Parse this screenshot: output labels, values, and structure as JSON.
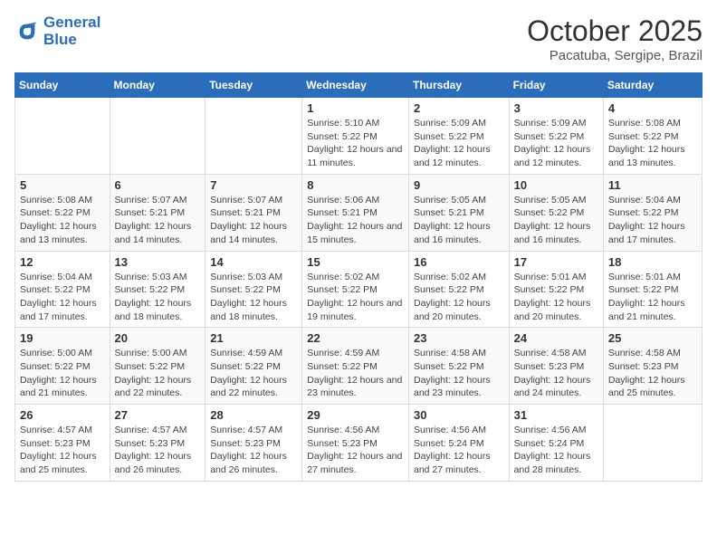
{
  "logo": {
    "line1": "General",
    "line2": "Blue"
  },
  "title": "October 2025",
  "subtitle": "Pacatuba, Sergipe, Brazil",
  "weekdays": [
    "Sunday",
    "Monday",
    "Tuesday",
    "Wednesday",
    "Thursday",
    "Friday",
    "Saturday"
  ],
  "weeks": [
    [
      {
        "day": "",
        "info": ""
      },
      {
        "day": "",
        "info": ""
      },
      {
        "day": "",
        "info": ""
      },
      {
        "day": "1",
        "sunrise": "5:10 AM",
        "sunset": "5:22 PM",
        "daylight": "12 hours and 11 minutes."
      },
      {
        "day": "2",
        "sunrise": "5:09 AM",
        "sunset": "5:22 PM",
        "daylight": "12 hours and 12 minutes."
      },
      {
        "day": "3",
        "sunrise": "5:09 AM",
        "sunset": "5:22 PM",
        "daylight": "12 hours and 12 minutes."
      },
      {
        "day": "4",
        "sunrise": "5:08 AM",
        "sunset": "5:22 PM",
        "daylight": "12 hours and 13 minutes."
      }
    ],
    [
      {
        "day": "5",
        "sunrise": "5:08 AM",
        "sunset": "5:22 PM",
        "daylight": "12 hours and 13 minutes."
      },
      {
        "day": "6",
        "sunrise": "5:07 AM",
        "sunset": "5:21 PM",
        "daylight": "12 hours and 14 minutes."
      },
      {
        "day": "7",
        "sunrise": "5:07 AM",
        "sunset": "5:21 PM",
        "daylight": "12 hours and 14 minutes."
      },
      {
        "day": "8",
        "sunrise": "5:06 AM",
        "sunset": "5:21 PM",
        "daylight": "12 hours and 15 minutes."
      },
      {
        "day": "9",
        "sunrise": "5:05 AM",
        "sunset": "5:21 PM",
        "daylight": "12 hours and 16 minutes."
      },
      {
        "day": "10",
        "sunrise": "5:05 AM",
        "sunset": "5:22 PM",
        "daylight": "12 hours and 16 minutes."
      },
      {
        "day": "11",
        "sunrise": "5:04 AM",
        "sunset": "5:22 PM",
        "daylight": "12 hours and 17 minutes."
      }
    ],
    [
      {
        "day": "12",
        "sunrise": "5:04 AM",
        "sunset": "5:22 PM",
        "daylight": "12 hours and 17 minutes."
      },
      {
        "day": "13",
        "sunrise": "5:03 AM",
        "sunset": "5:22 PM",
        "daylight": "12 hours and 18 minutes."
      },
      {
        "day": "14",
        "sunrise": "5:03 AM",
        "sunset": "5:22 PM",
        "daylight": "12 hours and 18 minutes."
      },
      {
        "day": "15",
        "sunrise": "5:02 AM",
        "sunset": "5:22 PM",
        "daylight": "12 hours and 19 minutes."
      },
      {
        "day": "16",
        "sunrise": "5:02 AM",
        "sunset": "5:22 PM",
        "daylight": "12 hours and 20 minutes."
      },
      {
        "day": "17",
        "sunrise": "5:01 AM",
        "sunset": "5:22 PM",
        "daylight": "12 hours and 20 minutes."
      },
      {
        "day": "18",
        "sunrise": "5:01 AM",
        "sunset": "5:22 PM",
        "daylight": "12 hours and 21 minutes."
      }
    ],
    [
      {
        "day": "19",
        "sunrise": "5:00 AM",
        "sunset": "5:22 PM",
        "daylight": "12 hours and 21 minutes."
      },
      {
        "day": "20",
        "sunrise": "5:00 AM",
        "sunset": "5:22 PM",
        "daylight": "12 hours and 22 minutes."
      },
      {
        "day": "21",
        "sunrise": "4:59 AM",
        "sunset": "5:22 PM",
        "daylight": "12 hours and 22 minutes."
      },
      {
        "day": "22",
        "sunrise": "4:59 AM",
        "sunset": "5:22 PM",
        "daylight": "12 hours and 23 minutes."
      },
      {
        "day": "23",
        "sunrise": "4:58 AM",
        "sunset": "5:22 PM",
        "daylight": "12 hours and 23 minutes."
      },
      {
        "day": "24",
        "sunrise": "4:58 AM",
        "sunset": "5:23 PM",
        "daylight": "12 hours and 24 minutes."
      },
      {
        "day": "25",
        "sunrise": "4:58 AM",
        "sunset": "5:23 PM",
        "daylight": "12 hours and 25 minutes."
      }
    ],
    [
      {
        "day": "26",
        "sunrise": "4:57 AM",
        "sunset": "5:23 PM",
        "daylight": "12 hours and 25 minutes."
      },
      {
        "day": "27",
        "sunrise": "4:57 AM",
        "sunset": "5:23 PM",
        "daylight": "12 hours and 26 minutes."
      },
      {
        "day": "28",
        "sunrise": "4:57 AM",
        "sunset": "5:23 PM",
        "daylight": "12 hours and 26 minutes."
      },
      {
        "day": "29",
        "sunrise": "4:56 AM",
        "sunset": "5:23 PM",
        "daylight": "12 hours and 27 minutes."
      },
      {
        "day": "30",
        "sunrise": "4:56 AM",
        "sunset": "5:24 PM",
        "daylight": "12 hours and 27 minutes."
      },
      {
        "day": "31",
        "sunrise": "4:56 AM",
        "sunset": "5:24 PM",
        "daylight": "12 hours and 28 minutes."
      },
      {
        "day": "",
        "info": ""
      }
    ]
  ]
}
